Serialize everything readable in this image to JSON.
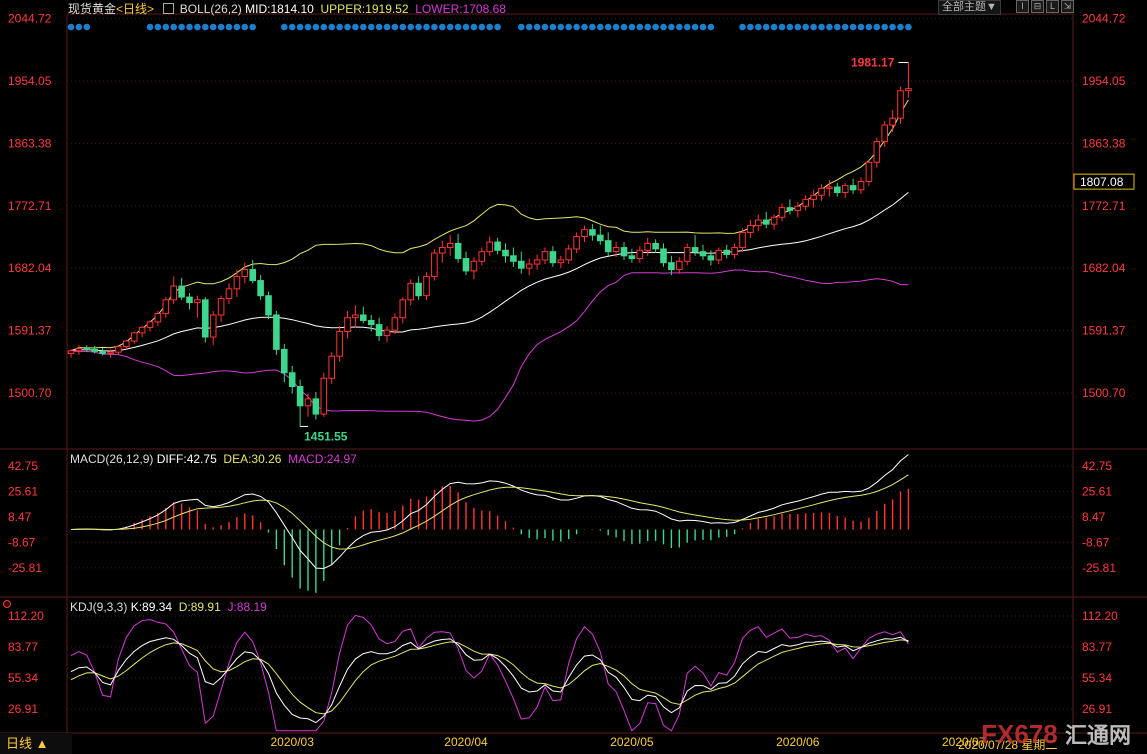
{
  "header": {
    "instrument": "现货黄金",
    "period": "<日线>",
    "boll_label": "BOLL(26,2)",
    "mid": "MID:1814.10",
    "upper": "UPPER:1919.52",
    "lower": "LOWER:1708.68",
    "theme_button": "全部主题▼"
  },
  "macd_header": {
    "label": "MACD(26,12,9)",
    "diff": "DIFF:42.75",
    "dea": "DEA:30.26",
    "macd": "MACD:24.97"
  },
  "kdj_header": {
    "label": "KDJ(9,3,3)",
    "k": "K:89.34",
    "d": "D:89.91",
    "j": "J:88.19"
  },
  "footer": {
    "period_tab": "日线 ▲",
    "cursor_date": "2020/07/28 星期二",
    "watermark": "FX678",
    "watermark_cn": "汇通网"
  },
  "colors": {
    "up": "#ff3333",
    "down": "#3dd68c",
    "boll_mid": "#ffffff",
    "boll_upper": "#e6e66a",
    "boll_lower": "#d63ad6",
    "price_axis": "#ff3a3a",
    "grid": "#3a1a1a"
  },
  "chart_data": [
    {
      "type": "candlestick",
      "name": "price",
      "y_ticks": [
        2044.72,
        1954.05,
        1863.38,
        1772.71,
        1682.04,
        1591.37,
        1500.7
      ],
      "y_range": [
        1425,
        2050
      ],
      "current_price_label": "1807.08",
      "high_annotation": "1981.17",
      "low_annotation": "1451.55",
      "x_labels": [
        "2020/03",
        "2020/04",
        "2020/05",
        "2020/06",
        "2020/07"
      ],
      "x_label_index": [
        28,
        50,
        71,
        92,
        113
      ],
      "candles": [
        [
          1558,
          1564,
          1552,
          1562
        ],
        [
          1562,
          1570,
          1556,
          1565
        ],
        [
          1565,
          1570,
          1560,
          1564
        ],
        [
          1564,
          1569,
          1558,
          1561
        ],
        [
          1561,
          1566,
          1555,
          1558
        ],
        [
          1558,
          1564,
          1552,
          1560
        ],
        [
          1560,
          1570,
          1556,
          1568
        ],
        [
          1568,
          1578,
          1564,
          1576
        ],
        [
          1576,
          1590,
          1572,
          1588
        ],
        [
          1588,
          1598,
          1582,
          1596
        ],
        [
          1596,
          1606,
          1590,
          1604
        ],
        [
          1604,
          1620,
          1598,
          1616
        ],
        [
          1616,
          1640,
          1610,
          1636
        ],
        [
          1636,
          1670,
          1630,
          1656
        ],
        [
          1656,
          1668,
          1636,
          1640
        ],
        [
          1640,
          1646,
          1622,
          1632
        ],
        [
          1632,
          1642,
          1610,
          1636
        ],
        [
          1636,
          1640,
          1574,
          1582
        ],
        [
          1582,
          1620,
          1570,
          1614
        ],
        [
          1614,
          1642,
          1604,
          1638
        ],
        [
          1638,
          1660,
          1630,
          1652
        ],
        [
          1652,
          1680,
          1640,
          1670
        ],
        [
          1670,
          1690,
          1660,
          1680
        ],
        [
          1680,
          1694,
          1660,
          1664
        ],
        [
          1664,
          1672,
          1636,
          1642
        ],
        [
          1642,
          1648,
          1608,
          1614
        ],
        [
          1614,
          1620,
          1556,
          1564
        ],
        [
          1564,
          1572,
          1516,
          1530
        ],
        [
          1530,
          1540,
          1500,
          1510
        ],
        [
          1510,
          1520,
          1452,
          1482
        ],
        [
          1482,
          1500,
          1466,
          1492
        ],
        [
          1492,
          1502,
          1462,
          1470
        ],
        [
          1470,
          1530,
          1466,
          1522
        ],
        [
          1522,
          1560,
          1514,
          1554
        ],
        [
          1554,
          1598,
          1546,
          1590
        ],
        [
          1590,
          1620,
          1580,
          1610
        ],
        [
          1610,
          1628,
          1596,
          1614
        ],
        [
          1614,
          1626,
          1602,
          1606
        ],
        [
          1606,
          1614,
          1590,
          1600
        ],
        [
          1600,
          1610,
          1576,
          1584
        ],
        [
          1584,
          1598,
          1574,
          1592
        ],
        [
          1592,
          1616,
          1586,
          1610
        ],
        [
          1610,
          1640,
          1602,
          1636
        ],
        [
          1636,
          1666,
          1628,
          1660
        ],
        [
          1660,
          1670,
          1636,
          1642
        ],
        [
          1642,
          1676,
          1636,
          1670
        ],
        [
          1670,
          1710,
          1664,
          1704
        ],
        [
          1704,
          1722,
          1690,
          1712
        ],
        [
          1712,
          1730,
          1700,
          1718
        ],
        [
          1718,
          1732,
          1690,
          1696
        ],
        [
          1696,
          1706,
          1672,
          1678
        ],
        [
          1678,
          1698,
          1666,
          1692
        ],
        [
          1692,
          1712,
          1686,
          1706
        ],
        [
          1706,
          1728,
          1700,
          1720
        ],
        [
          1720,
          1726,
          1702,
          1708
        ],
        [
          1708,
          1718,
          1690,
          1700
        ],
        [
          1700,
          1712,
          1684,
          1692
        ],
        [
          1692,
          1706,
          1674,
          1682
        ],
        [
          1682,
          1696,
          1672,
          1688
        ],
        [
          1688,
          1702,
          1680,
          1694
        ],
        [
          1694,
          1712,
          1688,
          1706
        ],
        [
          1706,
          1714,
          1684,
          1690
        ],
        [
          1690,
          1700,
          1682,
          1694
        ],
        [
          1694,
          1716,
          1688,
          1710
        ],
        [
          1710,
          1734,
          1704,
          1728
        ],
        [
          1728,
          1744,
          1720,
          1738
        ],
        [
          1738,
          1746,
          1722,
          1730
        ],
        [
          1730,
          1744,
          1716,
          1722
        ],
        [
          1722,
          1734,
          1700,
          1706
        ],
        [
          1706,
          1720,
          1698,
          1712
        ],
        [
          1712,
          1720,
          1694,
          1700
        ],
        [
          1700,
          1710,
          1690,
          1696
        ],
        [
          1696,
          1714,
          1690,
          1708
        ],
        [
          1708,
          1726,
          1700,
          1718
        ],
        [
          1718,
          1724,
          1704,
          1710
        ],
        [
          1710,
          1718,
          1684,
          1690
        ],
        [
          1690,
          1700,
          1672,
          1680
        ],
        [
          1680,
          1698,
          1674,
          1692
        ],
        [
          1692,
          1718,
          1686,
          1712
        ],
        [
          1712,
          1730,
          1700,
          1706
        ],
        [
          1706,
          1716,
          1694,
          1700
        ],
        [
          1700,
          1708,
          1686,
          1694
        ],
        [
          1694,
          1712,
          1688,
          1708
        ],
        [
          1708,
          1716,
          1696,
          1702
        ],
        [
          1702,
          1718,
          1696,
          1712
        ],
        [
          1712,
          1740,
          1706,
          1734
        ],
        [
          1734,
          1752,
          1726,
          1744
        ],
        [
          1744,
          1760,
          1736,
          1752
        ],
        [
          1752,
          1764,
          1740,
          1746
        ],
        [
          1746,
          1760,
          1738,
          1756
        ],
        [
          1756,
          1776,
          1750,
          1770
        ],
        [
          1770,
          1782,
          1760,
          1766
        ],
        [
          1766,
          1778,
          1756,
          1772
        ],
        [
          1772,
          1788,
          1766,
          1782
        ],
        [
          1782,
          1796,
          1770,
          1788
        ],
        [
          1788,
          1804,
          1780,
          1798
        ],
        [
          1798,
          1810,
          1786,
          1800
        ],
        [
          1800,
          1806,
          1786,
          1792
        ],
        [
          1792,
          1806,
          1784,
          1802
        ],
        [
          1802,
          1812,
          1790,
          1796
        ],
        [
          1796,
          1814,
          1790,
          1808
        ],
        [
          1808,
          1840,
          1802,
          1836
        ],
        [
          1836,
          1872,
          1828,
          1866
        ],
        [
          1866,
          1896,
          1858,
          1890
        ],
        [
          1890,
          1912,
          1880,
          1900
        ],
        [
          1900,
          1946,
          1892,
          1940
        ],
        [
          1940,
          1981,
          1930,
          1943
        ]
      ]
    },
    {
      "type": "histogram+line",
      "name": "macd",
      "y_ticks": [
        42.75,
        25.61,
        8.47,
        -8.67,
        -25.81
      ],
      "y_range": [
        -44,
        50
      ]
    },
    {
      "type": "line",
      "name": "kdj",
      "y_ticks": [
        112.2,
        83.77,
        55.34,
        26.91
      ],
      "y_range": [
        5,
        125
      ]
    }
  ]
}
